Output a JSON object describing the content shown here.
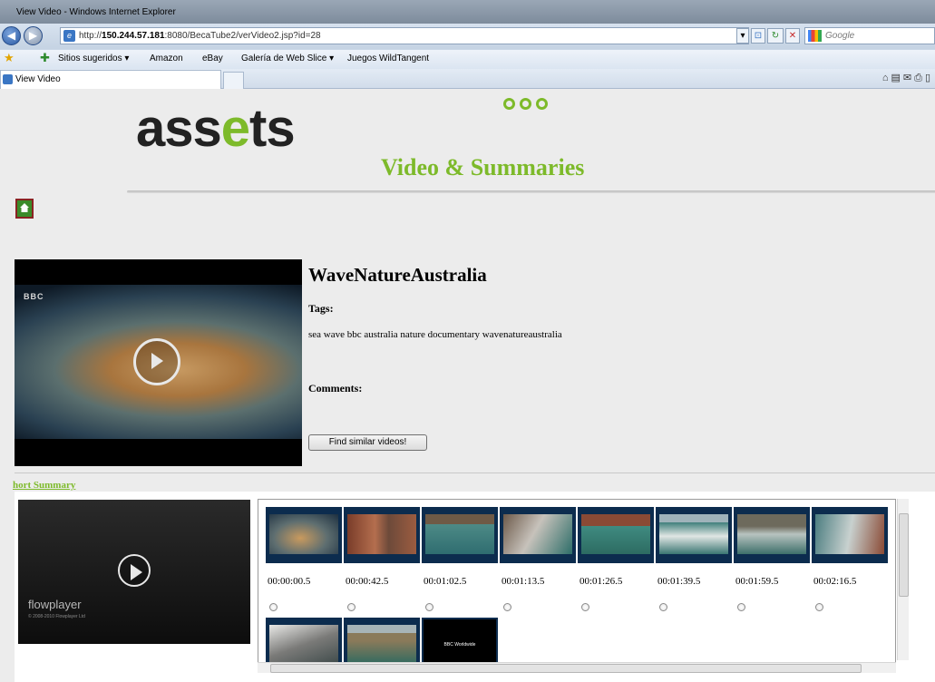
{
  "window": {
    "title": "View Video - Windows Internet Explorer"
  },
  "address_bar": {
    "url_prefix": "http://",
    "url_host": "150.244.57.181",
    "url_rest": ":8080/BecaTube2/verVideo2.jsp?id=28",
    "search_placeholder": "Google"
  },
  "favorites": {
    "items": [
      "Sitios sugeridos ▾",
      "Amazon",
      "eBay",
      "Galería de Web Slice ▾",
      "Juegos WildTangent"
    ]
  },
  "tabs": [
    {
      "label": "View Video"
    }
  ],
  "page": {
    "logo": "assets",
    "subtitle": "Video & Summaries",
    "video_title": "WaveNatureAustralia",
    "tags_label": "Tags:",
    "tags_value": "sea wave bbc australia nature documentary wavenatureaustralia",
    "comments_label": "Comments:",
    "similar_button": "Find similar videos!",
    "short_summary_link": "hort Summary",
    "flowplayer_brand": "flowplayer",
    "flowplayer_copy": "© 2008-2010 Flowplayer Ltd",
    "bbc_watermark": "BBC",
    "accent_color": "#7dba2a"
  },
  "keyframes": [
    {
      "time": "00:00:00.5"
    },
    {
      "time": "00:00:42.5"
    },
    {
      "time": "00:01:02.5"
    },
    {
      "time": "00:01:13.5"
    },
    {
      "time": "00:01:26.5"
    },
    {
      "time": "00:01:39.5"
    },
    {
      "time": "00:01:59.5"
    },
    {
      "time": "00:02:16.5"
    },
    {
      "time": ""
    },
    {
      "time": ""
    },
    {
      "time": ""
    }
  ],
  "bbc_worldwide_label": "BBC Worldwide"
}
